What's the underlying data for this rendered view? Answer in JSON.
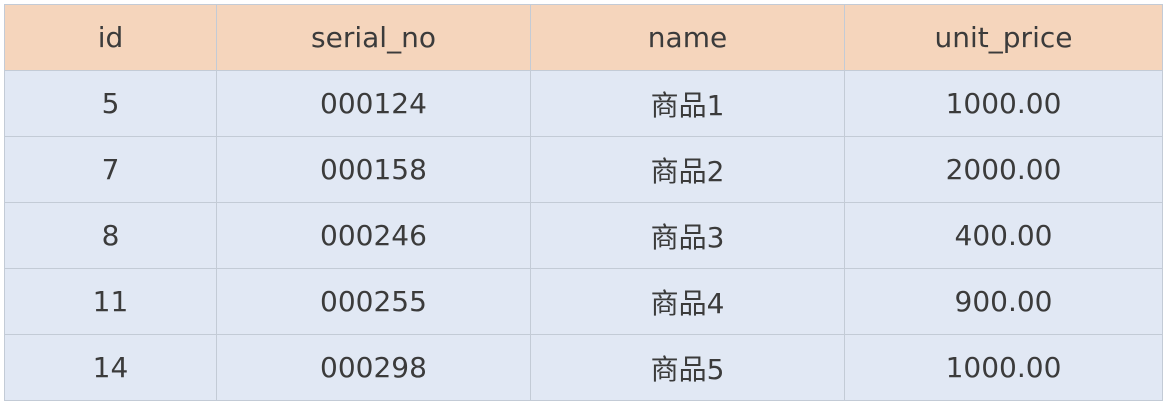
{
  "table": {
    "headers": [
      "id",
      "serial_no",
      "name",
      "unit_price"
    ],
    "rows": [
      [
        "5",
        "000124",
        "商品1",
        "1000.00"
      ],
      [
        "7",
        "000158",
        "商品2",
        "2000.00"
      ],
      [
        "8",
        "000246",
        "商品3",
        "400.00"
      ],
      [
        "11",
        "000255",
        "商品4",
        "900.00"
      ],
      [
        "14",
        "000298",
        "商品5",
        "1000.00"
      ]
    ]
  },
  "colors": {
    "header_bg": "#f5d5bc",
    "body_bg": "#e1e8f4",
    "border": "#c3cbd6",
    "text": "#3b3b3b"
  }
}
